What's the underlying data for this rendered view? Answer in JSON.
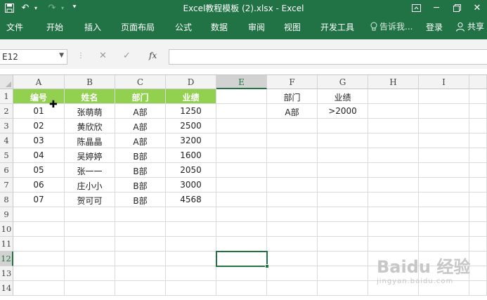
{
  "window": {
    "title": "Excel教程模板 (2).xlsx - Excel",
    "icons": {
      "save": "save-icon",
      "undo": "undo-icon",
      "redo": "redo-icon",
      "customize": "customize-qat-icon",
      "ribbon_options": "ribbon-display-options-icon",
      "minimize": "minimize-icon",
      "restore": "restore-icon",
      "close": "close-icon"
    }
  },
  "ribbon": {
    "tabs": [
      "文件",
      "开始",
      "插入",
      "页面布局",
      "公式",
      "数据",
      "审阅",
      "视图",
      "开发工具"
    ],
    "tell_me": "告诉我...",
    "signin": "登录",
    "share": "共享"
  },
  "formula_bar": {
    "name_box": "E12",
    "cancel": "✕",
    "enter": "✓",
    "fx": "fx",
    "value": ""
  },
  "sheet": {
    "columns": [
      "A",
      "B",
      "C",
      "D",
      "E",
      "F",
      "G",
      "H",
      "I"
    ],
    "rows": [
      "1",
      "2",
      "3",
      "4",
      "5",
      "6",
      "7",
      "8",
      "9",
      "10",
      "11",
      "12",
      "13",
      "14"
    ],
    "selected_cell": "E12",
    "header": [
      "编号",
      "姓名",
      "部门",
      "业绩"
    ],
    "records": [
      [
        "01",
        "张萌萌",
        "A部",
        "1250"
      ],
      [
        "02",
        "黄欣欣",
        "A部",
        "2500"
      ],
      [
        "03",
        "陈晶晶",
        "A部",
        "3200"
      ],
      [
        "04",
        "吴婷婷",
        "B部",
        "1600"
      ],
      [
        "05",
        "张一一",
        "B部",
        "2050"
      ],
      [
        "06",
        "庄小小",
        "B部",
        "3000"
      ],
      [
        "07",
        "贺可可",
        "B部",
        "4568"
      ]
    ],
    "criteria": {
      "header": [
        "部门",
        "业绩"
      ],
      "values": [
        "A部",
        ">2000"
      ]
    }
  },
  "watermark": {
    "main": "Baidu 经验",
    "sub": "jingyan.baidu.com"
  },
  "colors": {
    "excel_green": "#217346",
    "header_fill": "#92d050"
  }
}
